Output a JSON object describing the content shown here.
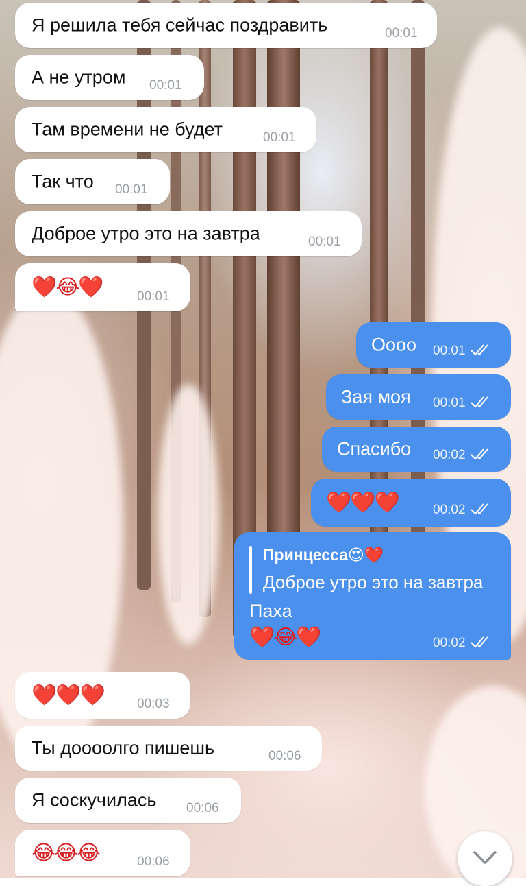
{
  "messages": [
    {
      "text": "Я решила тебя сейчас поздравить",
      "time": "00:01",
      "direction": "incoming"
    },
    {
      "text": "А не утром",
      "time": "00:01",
      "direction": "incoming"
    },
    {
      "text": "Там времени не будет",
      "time": "00:01",
      "direction": "incoming"
    },
    {
      "text": "Так что",
      "time": "00:01",
      "direction": "incoming"
    },
    {
      "text": "Доброе утро это на завтра",
      "time": "00:01",
      "direction": "incoming"
    },
    {
      "text": "❤️😂❤️",
      "time": "00:01",
      "direction": "incoming"
    },
    {
      "text": "Оооо",
      "time": "00:01",
      "direction": "outgoing",
      "status": "read"
    },
    {
      "text": "Зая моя",
      "time": "00:01",
      "direction": "outgoing",
      "status": "read"
    },
    {
      "text": "Спасибо",
      "time": "00:02",
      "direction": "outgoing",
      "status": "read"
    },
    {
      "text": "❤️❤️❤️",
      "time": "00:02",
      "direction": "outgoing",
      "status": "read"
    },
    {
      "reply_to": {
        "name": "Принцесса😍❤️",
        "text": "Доброе утро это на завтра"
      },
      "text": "Паха",
      "text2": "❤️😂❤️",
      "time": "00:02",
      "direction": "outgoing",
      "status": "read"
    },
    {
      "text": "❤️❤️❤️",
      "time": "00:03",
      "direction": "incoming"
    },
    {
      "text": "Ты доооолго пишешь",
      "time": "00:06",
      "direction": "incoming"
    },
    {
      "text": "Я соскучилась",
      "time": "00:06",
      "direction": "incoming"
    },
    {
      "text": "😂😂😂",
      "time": "00:06",
      "direction": "incoming"
    }
  ],
  "colors": {
    "incoming_bubble": "#ffffff",
    "outgoing_bubble": "#4a90ec"
  },
  "scroll_button": {
    "icon": "chevron-down-icon"
  }
}
